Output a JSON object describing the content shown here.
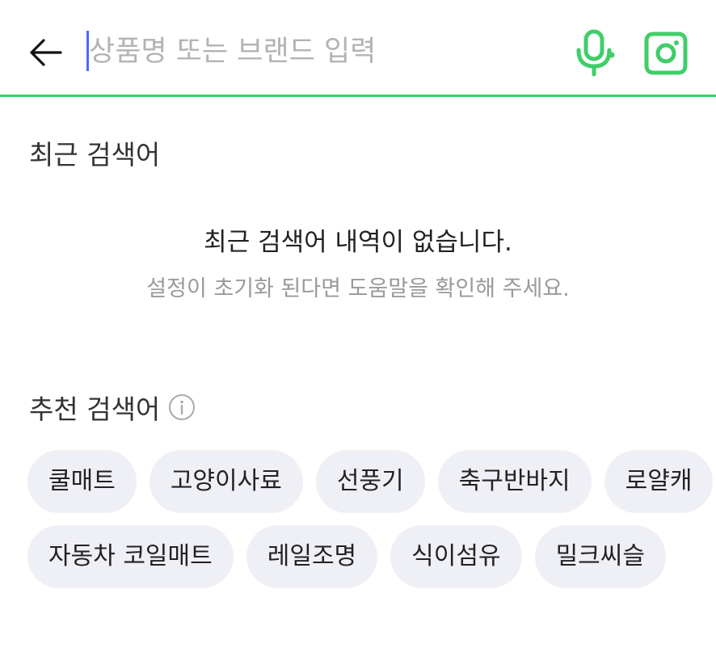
{
  "header": {
    "search_placeholder": "상품명 또는 브랜드 입력",
    "accent_color": "#3fce69"
  },
  "icons": {
    "back": "back-arrow-icon",
    "voice": "microphone-icon",
    "lens": "camera-lens-icon",
    "info": "info-icon"
  },
  "recent": {
    "title": "최근 검색어",
    "empty_message": "최근 검색어 내역이 없습니다.",
    "empty_hint": "설정이 초기화 된다면 도움말을 확인해 주세요."
  },
  "recommended": {
    "title": "추천 검색어",
    "rows": [
      [
        "쿨매트",
        "고양이사료",
        "선풍기",
        "축구반바지",
        "로얄캐"
      ],
      [
        "자동차 코일매트",
        "레일조명",
        "식이섬유",
        "밀크씨슬"
      ]
    ]
  }
}
